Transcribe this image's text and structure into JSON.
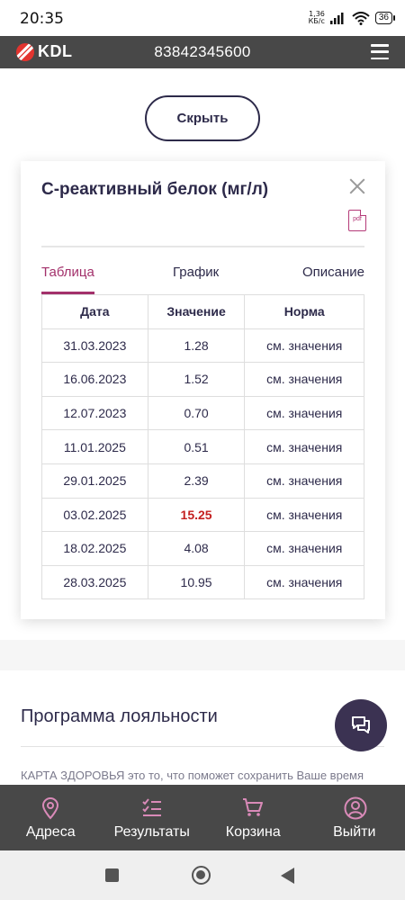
{
  "status_bar": {
    "time": "20:35",
    "speed_value": "1,36",
    "speed_unit": "КБ/с",
    "battery": "36"
  },
  "header": {
    "logo_text": "KDL",
    "phone": "83842345600"
  },
  "hide_button_label": "Скрыть",
  "card": {
    "title": "С-реактивный белок (мг/л)",
    "pdf_label": "pdf",
    "tabs": [
      {
        "label": "Таблица",
        "active": true
      },
      {
        "label": "График",
        "active": false
      },
      {
        "label": "Описание",
        "active": false
      }
    ],
    "table": {
      "headers": [
        "Дата",
        "Значение",
        "Норма"
      ],
      "rows": [
        {
          "date": "31.03.2023",
          "value": "1.28",
          "norm": "см. значения"
        },
        {
          "date": "16.06.2023",
          "value": "1.52",
          "norm": "см. значения"
        },
        {
          "date": "12.07.2023",
          "value": "0.70",
          "norm": "см. значения"
        },
        {
          "date": "11.01.2025",
          "value": "0.51",
          "norm": "см. значения"
        },
        {
          "date": "29.01.2025",
          "value": "2.39",
          "norm": "см. значения"
        },
        {
          "date": "03.02.2025",
          "value": "15.25",
          "norm": "см. значения",
          "highlight": true
        },
        {
          "date": "18.02.2025",
          "value": "4.08",
          "norm": "см. значения"
        },
        {
          "date": "28.03.2025",
          "value": "10.95",
          "norm": "см. значения"
        }
      ]
    }
  },
  "loyalty": {
    "title": "Программа лояльности",
    "text": "КАРТА ЗДОРОВЬЯ это то, что поможет сохранить Ваше время"
  },
  "bottom_nav": [
    {
      "label": "Адреса",
      "icon": "location-pin-icon"
    },
    {
      "label": "Результаты",
      "icon": "checklist-icon"
    },
    {
      "label": "Корзина",
      "icon": "cart-icon"
    },
    {
      "label": "Выйти",
      "icon": "user-icon"
    }
  ],
  "colors": {
    "accent": "#a3316b",
    "header_bg": "#484848",
    "text_dark": "#2d2a4a",
    "alert_red": "#c42020",
    "icon_pink": "#d98ab8"
  }
}
